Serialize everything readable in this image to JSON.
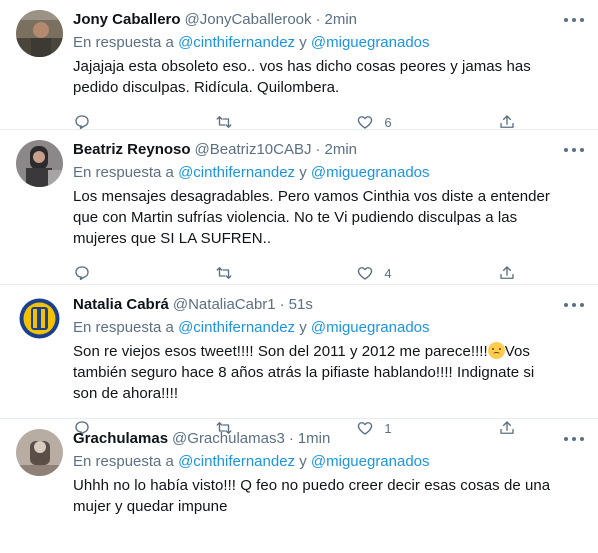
{
  "tweets": [
    {
      "display_name": "Jony Caballero",
      "handle": "@JonyCaballerook",
      "separator": "·",
      "time": "2min",
      "reply_prefix": "En respuesta a",
      "mention_1": "@cinthifernandez",
      "reply_and": "y",
      "mention_2": "@miguegranados",
      "text": "Jajajaja esta obsoleto eso.. vos has dicho cosas peores y jamas has pedido disculpas. Ridícula. Quilombera.",
      "reply_count": "",
      "retweet_count": "",
      "like_count": "6",
      "avatar_colors": [
        "#7a7060",
        "#3d3a33"
      ]
    },
    {
      "display_name": "Beatriz Reynoso",
      "handle": "@Beatriz10CABJ",
      "separator": "·",
      "time": "2min",
      "reply_prefix": "En respuesta a",
      "mention_1": "@cinthifernandez",
      "reply_and": "y",
      "mention_2": "@miguegranados",
      "text": "Los mensajes desagradables. Pero vamos Cinthia vos diste a entender que con Martin sufrías violencia. No te Vi pudiendo disculpas a las mujeres que SI LA SUFREN..",
      "reply_count": "",
      "retweet_count": "",
      "like_count": "4",
      "avatar_colors": [
        "#8c8788",
        "#2b2a2c"
      ]
    },
    {
      "display_name": "Natalia Cabrá",
      "handle": "@NataliaCabr1",
      "separator": "·",
      "time": "51s",
      "reply_prefix": "En respuesta a",
      "mention_1": "@cinthifernandez",
      "reply_and": "y",
      "mention_2": "@miguegranados",
      "text_before_emoji": "Son re viejos esos tweet!!!! Son del 2011 y 2012 me parece!!!!",
      "emoji": "confused-face",
      "text_after_emoji": "Vos también seguro hace 8 años atrás la pifiaste hablando!!!! Indignate si son de ahora!!!!",
      "reply_count": "",
      "retweet_count": "",
      "like_count": "1",
      "avatar_colors": [
        "#1a3f8f",
        "#f2c200"
      ]
    },
    {
      "display_name": "Grachulamas",
      "handle": "@Grachulamas3",
      "separator": "·",
      "time": "1min",
      "reply_prefix": "En respuesta a",
      "mention_1": "@cinthifernandez",
      "reply_and": "y",
      "mention_2": "@miguegranados",
      "text": "Uhhh no lo había visto!!! Q feo no puedo creer decir esas cosas de una mujer y quedar impune",
      "avatar_colors": [
        "#b8ada3",
        "#5a4e46"
      ]
    }
  ],
  "colors": {
    "mention": "#1b95e0",
    "secondary_text": "#5b7083",
    "divider": "#e6ecf0"
  },
  "icons": [
    "more-icon",
    "reply-icon",
    "retweet-icon",
    "like-icon",
    "share-icon"
  ]
}
